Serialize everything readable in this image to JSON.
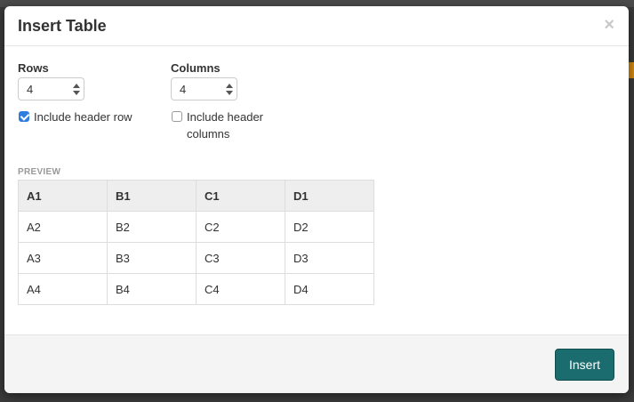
{
  "dialog": {
    "title": "Insert Table",
    "close_symbol": "×",
    "rows": {
      "label": "Rows",
      "value": "4"
    },
    "columns": {
      "label": "Columns",
      "value": "4"
    },
    "include_header_row": {
      "label": "Include header row",
      "checked": true
    },
    "include_header_columns": {
      "label_line1": "Include header",
      "label_line2": "columns",
      "checked": false
    },
    "preview": {
      "label": "PREVIEW",
      "header": [
        "A1",
        "B1",
        "C1",
        "D1"
      ],
      "rows": [
        [
          "A2",
          "B2",
          "C2",
          "D2"
        ],
        [
          "A3",
          "B3",
          "C3",
          "D3"
        ],
        [
          "A4",
          "B4",
          "C4",
          "D4"
        ]
      ]
    },
    "insert_label": "Insert"
  },
  "colors": {
    "primary_button": "#1b6c6e",
    "checkbox_checked": "#2f7de1"
  },
  "icons": {
    "close": "close-icon",
    "spinner": "spinner-arrows-icon",
    "check": "check-icon"
  }
}
